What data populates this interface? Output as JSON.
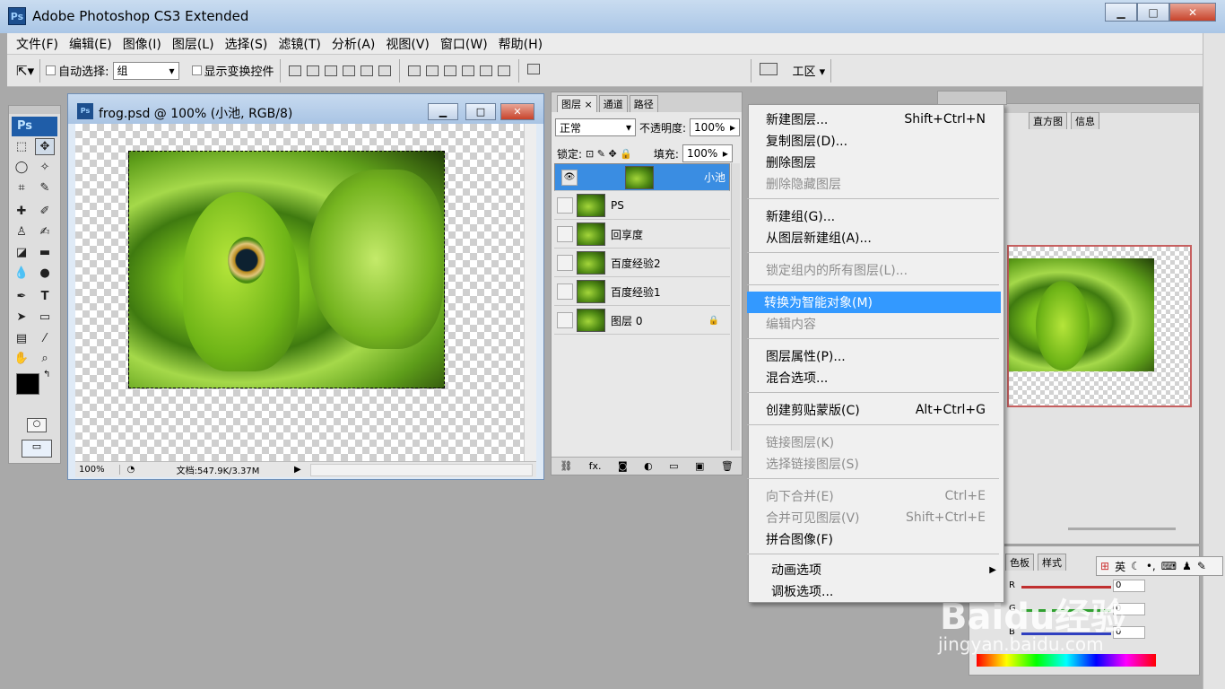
{
  "app": {
    "title": "Adobe Photoshop CS3 Extended",
    "logo": "Ps"
  },
  "menubar": [
    "文件(F)",
    "编辑(E)",
    "图像(I)",
    "图层(L)",
    "选择(S)",
    "滤镜(T)",
    "分析(A)",
    "视图(V)",
    "窗口(W)",
    "帮助(H)"
  ],
  "options": {
    "auto_select_label": "自动选择:",
    "auto_select_value": "组",
    "show_transform_label": "显示变换控件",
    "workspace_label": "工区"
  },
  "toolbox": {
    "logo": "Ps"
  },
  "document": {
    "title": "frog.psd @ 100% (小池, RGB/8)",
    "zoom": "100%",
    "doc_info": "文档:547.9K/3.37M"
  },
  "layers_panel": {
    "tabs": [
      "图层",
      "通道",
      "路径"
    ],
    "blend_mode": "正常",
    "opacity_label": "不透明度:",
    "opacity_value": "100%",
    "lock_label": "锁定:",
    "fill_label": "填充:",
    "fill_value": "100%",
    "layers": [
      {
        "name": "小池",
        "selected": true,
        "visible": true
      },
      {
        "name": "PS",
        "selected": false,
        "visible": false
      },
      {
        "name": "回享度",
        "selected": false,
        "visible": false
      },
      {
        "name": "百度经验2",
        "selected": false,
        "visible": false
      },
      {
        "name": "百度经验1",
        "selected": false,
        "visible": false
      },
      {
        "name": "图层 0",
        "selected": false,
        "visible": false
      }
    ]
  },
  "right_panels": {
    "tabs": [
      "直方图",
      "信息"
    ],
    "color_tabs": [
      "色板",
      "样式"
    ],
    "r_label": "R",
    "g_label": "G",
    "b_label": "B",
    "r_value": "0",
    "g_value": "0",
    "b_value": "0"
  },
  "context_menu": [
    {
      "label": "新建图层...",
      "shortcut": "Shift+Ctrl+N",
      "disabled": false
    },
    {
      "label": "复制图层(D)...",
      "shortcut": "",
      "disabled": false
    },
    {
      "label": "删除图层",
      "shortcut": "",
      "disabled": false
    },
    {
      "label": "删除隐藏图层",
      "shortcut": "",
      "disabled": true
    },
    {
      "label": "新建组(G)...",
      "shortcut": "",
      "disabled": false
    },
    {
      "label": "从图层新建组(A)...",
      "shortcut": "",
      "disabled": false
    },
    {
      "label": "锁定组内的所有图层(L)...",
      "shortcut": "",
      "disabled": true
    },
    {
      "label": "转换为智能对象(M)",
      "shortcut": "",
      "disabled": false,
      "highlighted": true
    },
    {
      "label": "编辑内容",
      "shortcut": "",
      "disabled": true
    },
    {
      "label": "图层属性(P)...",
      "shortcut": "",
      "disabled": false
    },
    {
      "label": "混合选项...",
      "shortcut": "",
      "disabled": false
    },
    {
      "label": "创建剪贴蒙版(C)",
      "shortcut": "Alt+Ctrl+G",
      "disabled": false
    },
    {
      "label": "链接图层(K)",
      "shortcut": "",
      "disabled": true
    },
    {
      "label": "选择链接图层(S)",
      "shortcut": "",
      "disabled": true
    },
    {
      "label": "向下合并(E)",
      "shortcut": "Ctrl+E",
      "disabled": true
    },
    {
      "label": "合并可见图层(V)",
      "shortcut": "Shift+Ctrl+E",
      "disabled": true
    },
    {
      "label": "拼合图像(F)",
      "shortcut": "",
      "disabled": false
    },
    {
      "label": "动画选项",
      "shortcut": "",
      "disabled": false,
      "submenu": true
    },
    {
      "label": "调板选项...",
      "shortcut": "",
      "disabled": false
    }
  ],
  "ime": {
    "chars": "英"
  },
  "watermark": {
    "main": "Baidu经验",
    "sub": "jingyan.baidu.com"
  },
  "colors": {
    "selection": "#3a8de2",
    "menu_highlight": "#3399ff",
    "nav_frame": "#c65f5f"
  }
}
